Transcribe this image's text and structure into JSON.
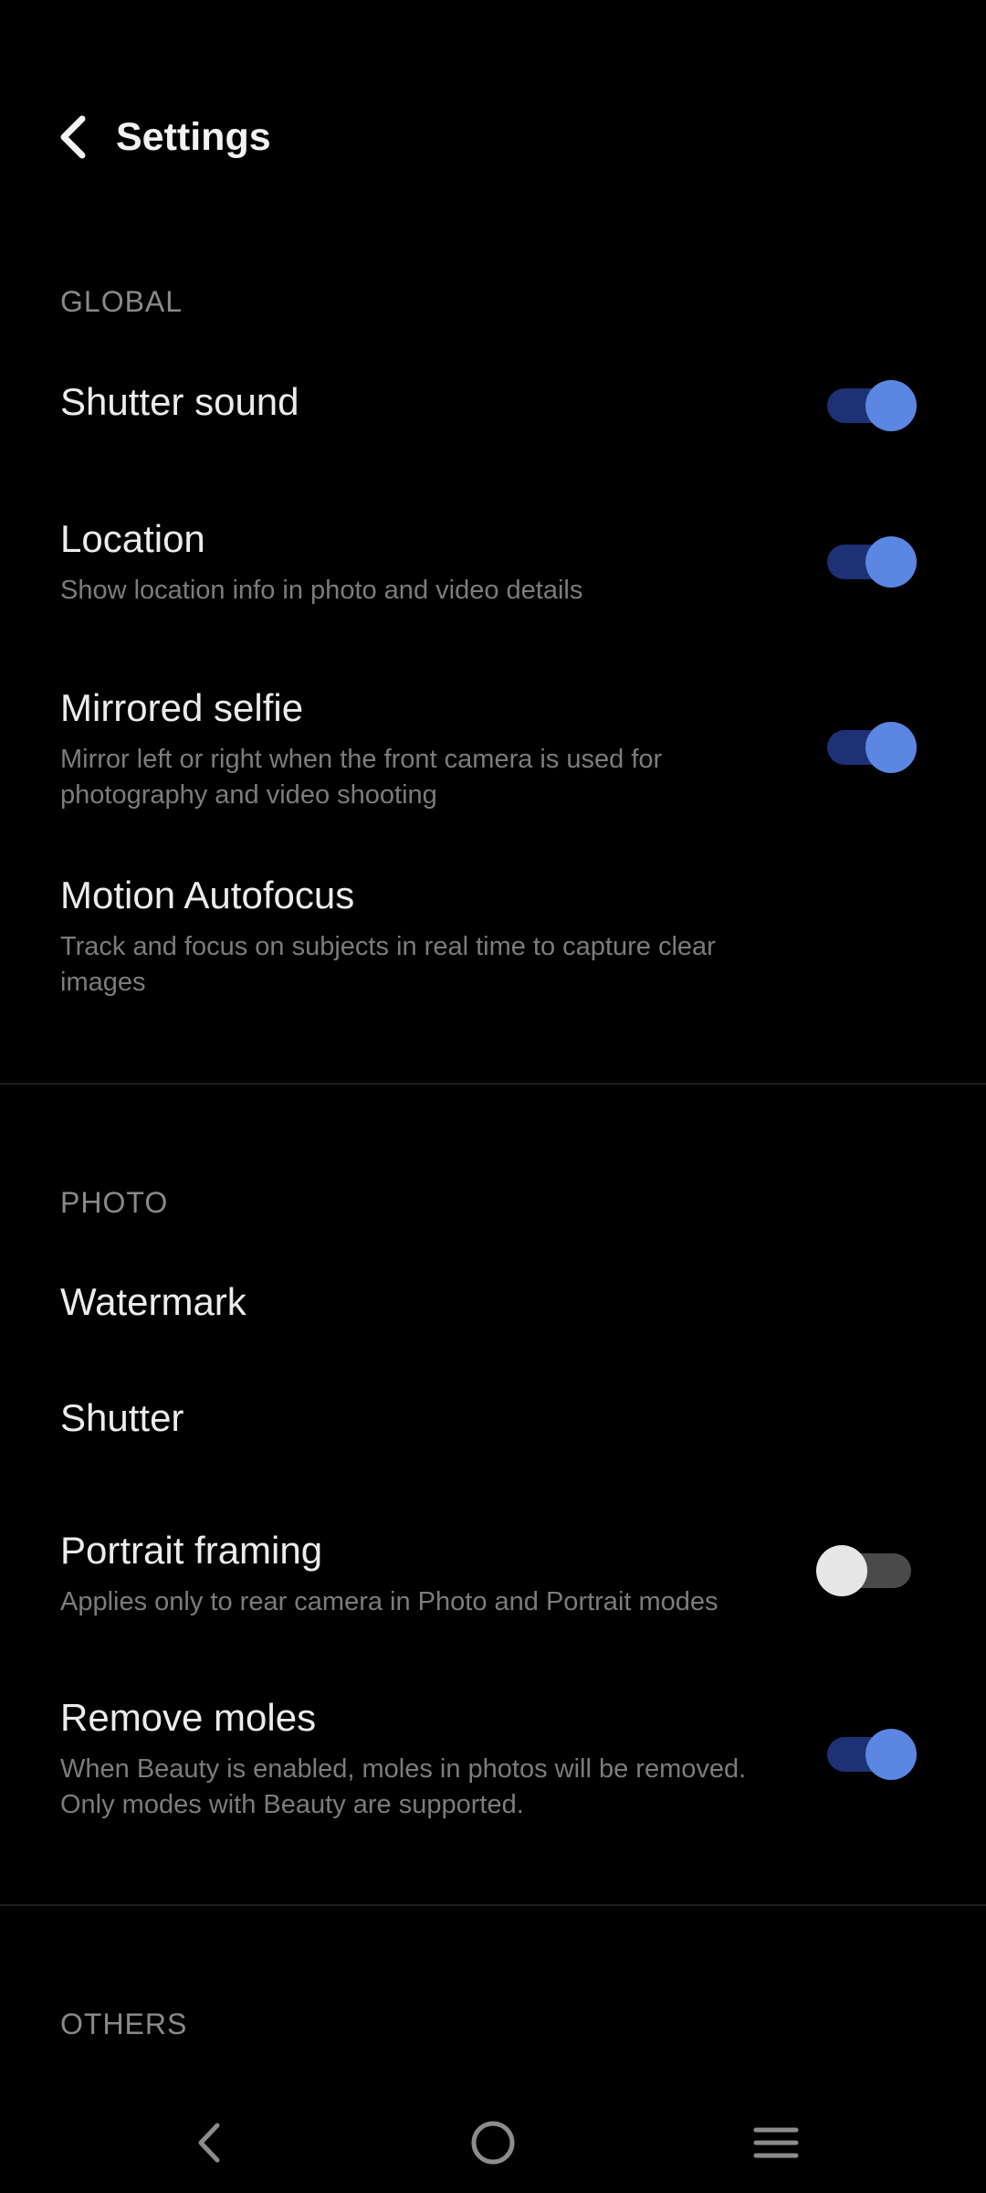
{
  "header": {
    "back_icon": "chevron-left-icon",
    "title": "Settings"
  },
  "sections": {
    "global": {
      "title": "GLOBAL",
      "items": {
        "shutter_sound": {
          "title": "Shutter sound",
          "toggle": "on"
        },
        "location": {
          "title": "Location",
          "description": "Show location info in photo and video details",
          "toggle": "on"
        },
        "mirrored_selfie": {
          "title": "Mirrored selfie",
          "description": "Mirror left or right when the front camera is used for photography and video shooting",
          "toggle": "on"
        },
        "motion_autofocus": {
          "title": "Motion Autofocus",
          "description": "Track and focus on subjects in real time to capture clear images"
        }
      }
    },
    "photo": {
      "title": "PHOTO",
      "items": {
        "watermark": {
          "title": "Watermark"
        },
        "shutter": {
          "title": "Shutter"
        },
        "portrait_framing": {
          "title": "Portrait framing",
          "description": "Applies only to rear camera in Photo and Portrait modes",
          "toggle": "off"
        },
        "remove_moles": {
          "title": "Remove moles",
          "description": "When Beauty is enabled, moles in photos will be removed. Only modes with Beauty are supported.",
          "toggle": "on"
        }
      }
    },
    "others": {
      "title": "OTHERS"
    }
  },
  "navbar": {
    "back_icon": "triangle-back-icon",
    "home_icon": "circle-home-icon",
    "recents_icon": "menu-lines-icon"
  },
  "colors": {
    "background": "#000000",
    "toggle_on_knob": "#5b86e2",
    "toggle_on_track": "#1e3174",
    "toggle_off_knob": "#e6e6e6",
    "toggle_off_track": "#4a4a4a",
    "secondary_text": "#7c7c7c"
  }
}
